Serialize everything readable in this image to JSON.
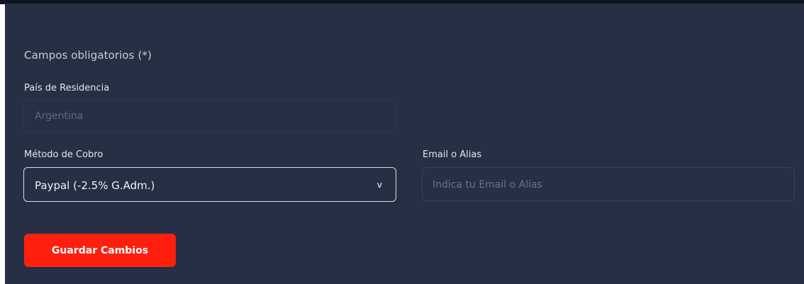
{
  "form": {
    "required_note": "Campos obligatorios (*)",
    "country": {
      "label": "País de Residencia",
      "value": "Argentina"
    },
    "payment_method": {
      "label": "Método de Cobro",
      "selected": "Paypal (-2.5% G.Adm.)",
      "icon": "chevron-down-icon"
    },
    "email_alias": {
      "label": "Email o Alias",
      "placeholder": "Indica tu Email o Alias"
    },
    "submit_label": "Guardar Cambios"
  },
  "colors": {
    "panel_bg": "#262f44",
    "accent": "#ff1f0f"
  }
}
